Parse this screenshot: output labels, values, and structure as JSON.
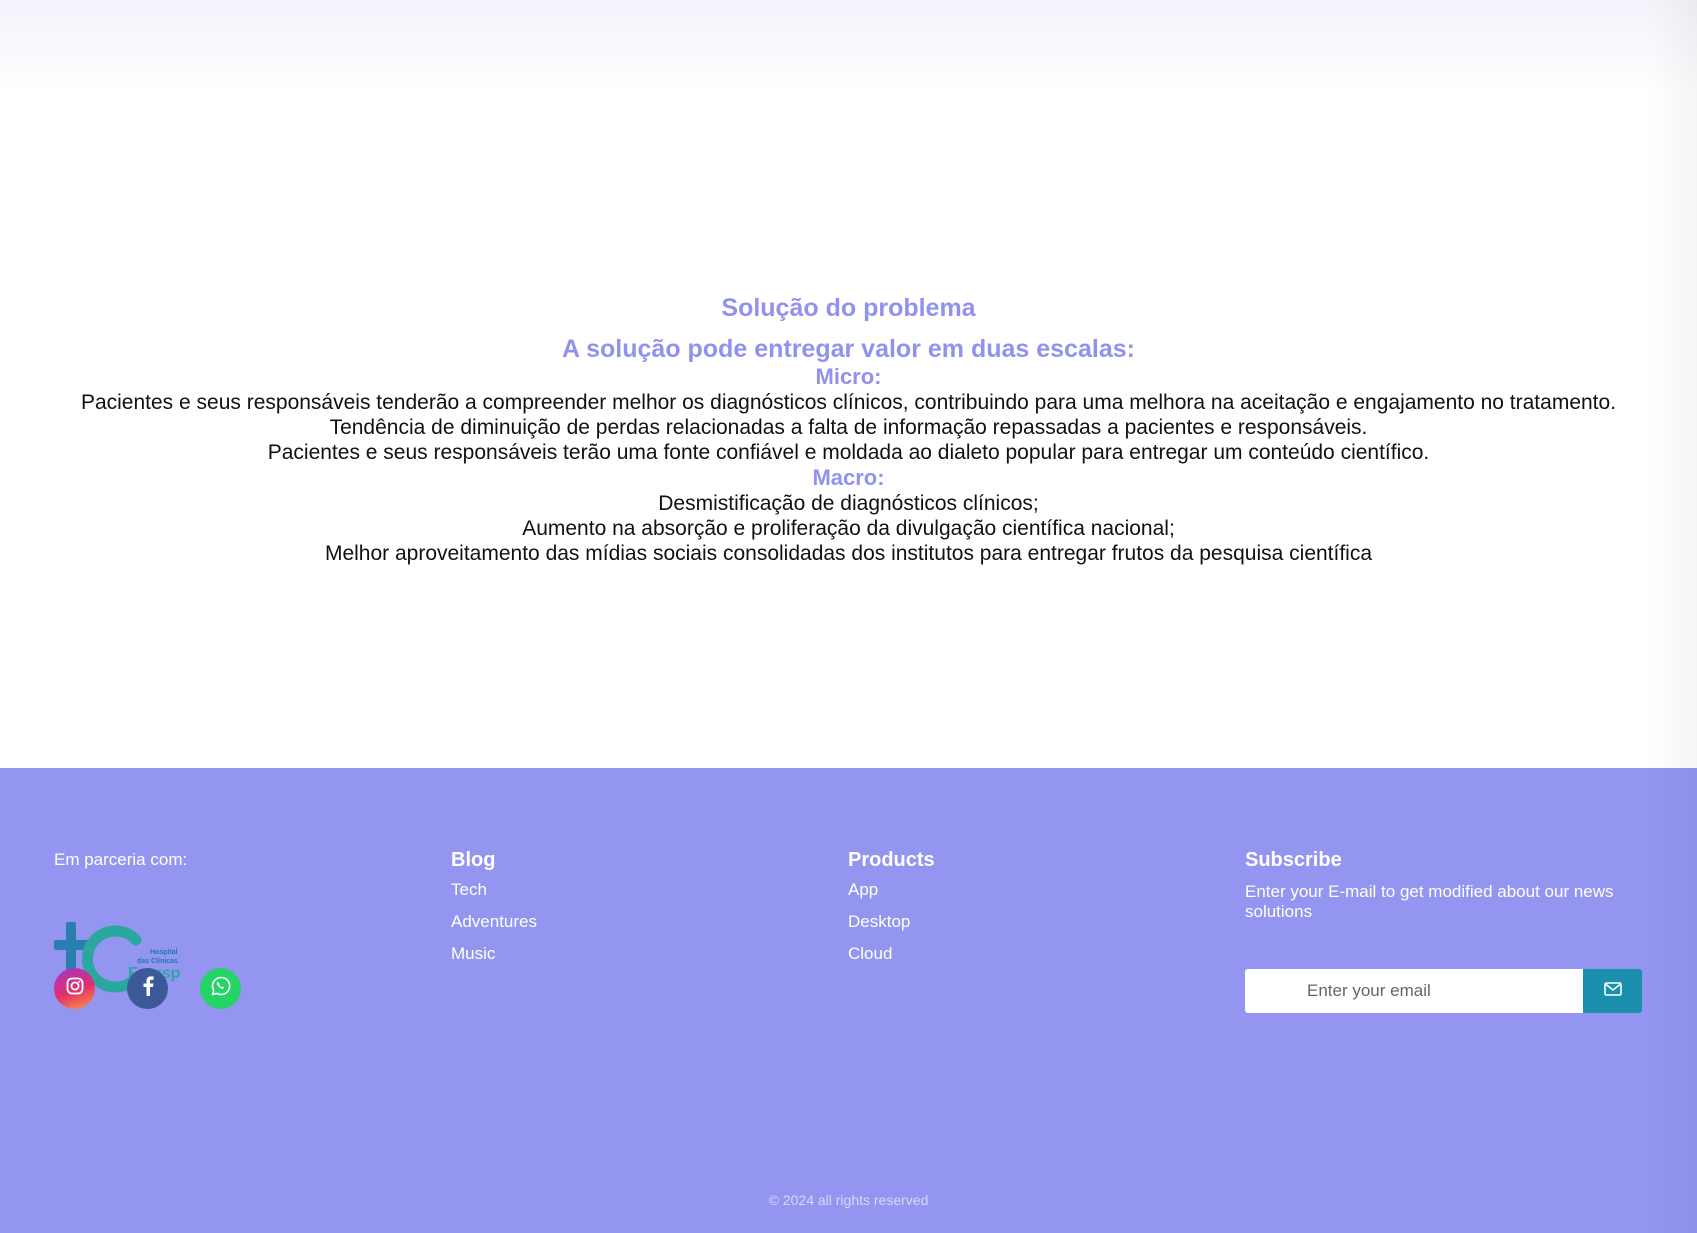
{
  "solution": {
    "title": "Solução do problema",
    "subtitle": "A solução pode entregar valor em duas escalas:",
    "micro_heading": "Micro:",
    "micro_lines": [
      "Pacientes e seus responsáveis tenderão a compreender melhor os diagnósticos clínicos, contribuindo para uma melhora na aceitação e engajamento no tratamento.",
      "Tendência de diminuição de perdas relacionadas a falta de informação repassadas a pacientes e responsáveis.",
      "Pacientes e seus responsáveis terão uma fonte confiável e moldada ao dialeto popular para entregar um conteúdo científico."
    ],
    "macro_heading": "Macro:",
    "macro_lines": [
      "Desmistificação de diagnósticos clínicos;",
      "Aumento na absorção e proliferação da divulgação científica nacional;",
      "Melhor aproveitamento das mídias sociais consolidadas dos institutos para entregar frutos da pesquisa científica"
    ]
  },
  "footer": {
    "partner_label": "Em parceria com:",
    "logo": {
      "icon": "hc-fmusp-logo",
      "text_line1": "Hospital",
      "text_line2": "das Clínicas",
      "text_line3": "Fmusp"
    },
    "socials": [
      {
        "icon": "instagram-icon",
        "color": "#e1306c"
      },
      {
        "icon": "facebook-icon",
        "color": "#3b5998"
      },
      {
        "icon": "whatsapp-icon",
        "color": "#25d366"
      }
    ],
    "blog": {
      "title": "Blog",
      "links": [
        "Tech",
        "Adventures",
        "Music"
      ]
    },
    "products": {
      "title": "Products",
      "links": [
        "App",
        "Desktop",
        "Cloud"
      ]
    },
    "subscribe": {
      "title": "Subscribe",
      "text": "Enter your E-mail to get modified about our news solutions",
      "placeholder": "Enter your email",
      "button_icon": "mail-icon"
    },
    "copyright": "© 2024 all rights reserved"
  },
  "colors": {
    "accent": "#9192ee",
    "footer_bg": "#9495f0",
    "button": "#1b8fad"
  }
}
